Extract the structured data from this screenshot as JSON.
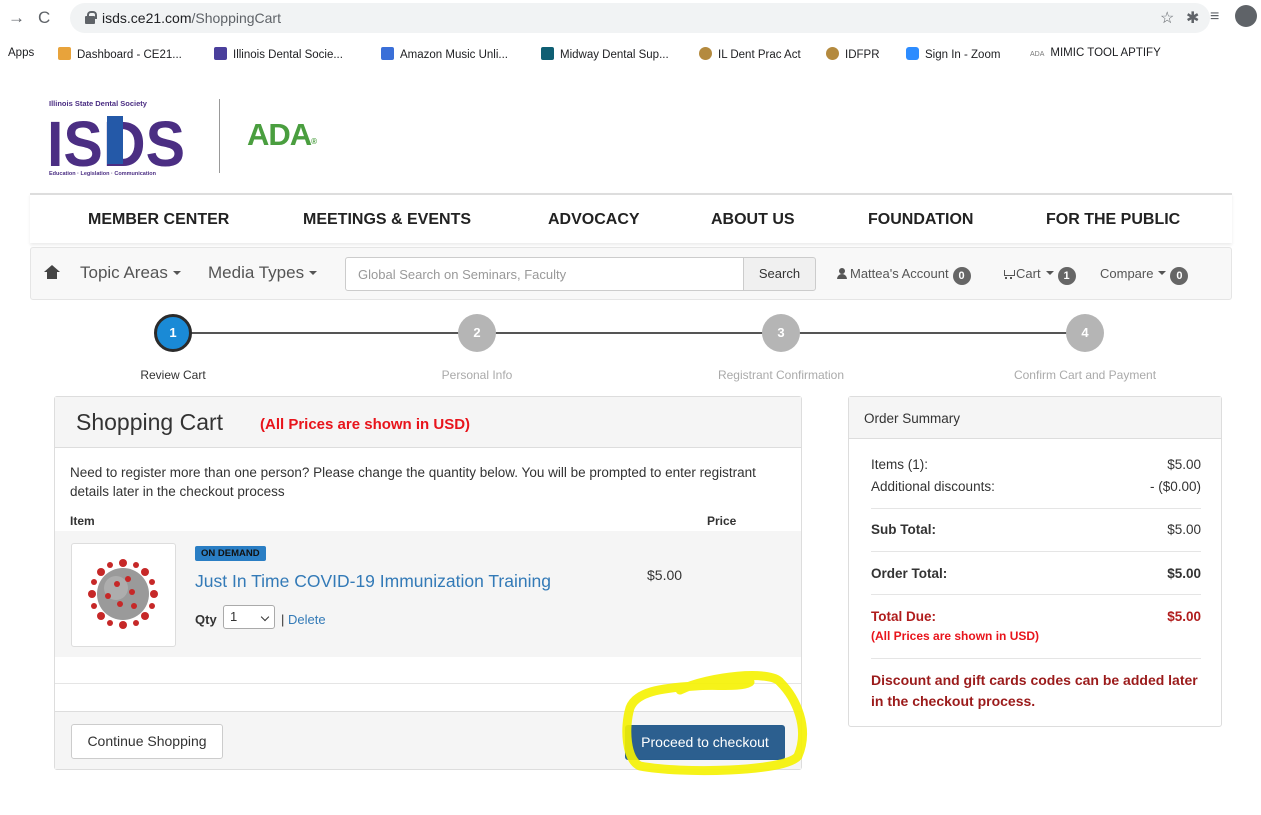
{
  "browser": {
    "url_host": "isds.ce21.com",
    "url_path": "/ShoppingCart",
    "bookmarks": [
      {
        "label": "Apps",
        "color": ""
      },
      {
        "label": "Dashboard - CE21...",
        "color": "#e8a33b"
      },
      {
        "label": "Illinois Dental Socie...",
        "color": "#4a3f9c"
      },
      {
        "label": "Amazon Music Unli...",
        "color": "#3a6fd8"
      },
      {
        "label": "Midway Dental Sup...",
        "color": "#0f5f73"
      },
      {
        "label": "IL Dent Prac Act",
        "color": "#b48a3e"
      },
      {
        "label": "IDFPR",
        "color": "#b48a3e"
      },
      {
        "label": "Sign In - Zoom",
        "color": "#2d8cff"
      },
      {
        "label": "MIMIC TOOL APTIFY",
        "color": "#7a7a7a"
      }
    ],
    "ada_mini_label": "ADA"
  },
  "logos": {
    "isds_top": "Illinois State Dental Society",
    "isds_letters": "ISDS",
    "isds_bottom": "Education · Legislation · Communication",
    "ada": "ADA"
  },
  "mainnav": [
    "MEMBER CENTER",
    "MEETINGS & EVENTS",
    "ADVOCACY",
    "ABOUT US",
    "FOUNDATION",
    "FOR THE PUBLIC"
  ],
  "toolbar": {
    "topic_areas": "Topic Areas",
    "media_types": "Media Types",
    "search_placeholder": "Global Search on Seminars, Faculty",
    "search_button": "Search",
    "account": "Mattea's Account",
    "account_count": "0",
    "cart": "Cart",
    "cart_count": "1",
    "compare": "Compare",
    "compare_count": "0"
  },
  "steps": [
    {
      "number": "1",
      "label": "Review Cart"
    },
    {
      "number": "2",
      "label": "Personal Info"
    },
    {
      "number": "3",
      "label": "Registrant Confirmation"
    },
    {
      "number": "4",
      "label": "Confirm Cart and Payment"
    }
  ],
  "cart": {
    "title": "Shopping Cart",
    "currency_note": "(All Prices are shown in USD)",
    "message": "Need to register more than one person? Please change the quantity below. You will be prompted to enter registrant details later in the checkout process",
    "col_item": "Item",
    "col_price": "Price",
    "item": {
      "tag": "ON DEMAND",
      "title": "Just In Time COVID-19 Immunization Training",
      "price": "$5.00",
      "qty_label": "Qty",
      "qty_value": "1",
      "separator": "|",
      "delete": "Delete"
    },
    "continue_button": "Continue Shopping",
    "checkout_button": "Proceed to checkout"
  },
  "summary": {
    "title": "Order Summary",
    "items_label": "Items (1):",
    "items_value": "$5.00",
    "discounts_label": "Additional discounts:",
    "discounts_value": "- ($0.00)",
    "subtotal_label": "Sub Total:",
    "subtotal_value": "$5.00",
    "order_total_label": "Order Total:",
    "order_total_value": "$5.00",
    "total_due_label": "Total Due:",
    "total_due_value": "$5.00",
    "currency_note": "(All Prices are shown in USD)",
    "discount_note": "Discount and gift cards codes can be added later in the checkout process."
  },
  "colors": {
    "highlight": "#f5f200",
    "accent_blue": "#1a8ad6",
    "link_blue": "#337ab7",
    "price_red": "#e8141b"
  }
}
